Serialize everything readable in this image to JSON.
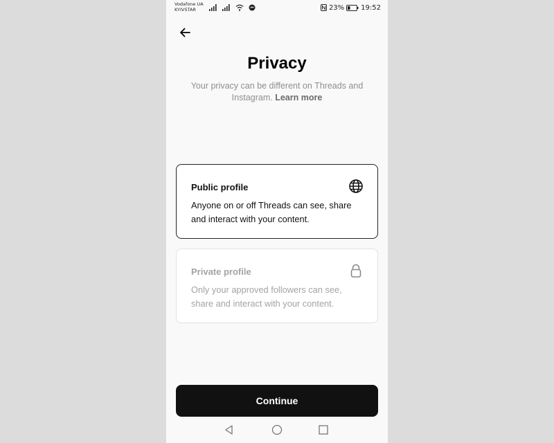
{
  "status_bar": {
    "carrier_line1": "Vodafone UA",
    "carrier_line2": "KYIVSTAR",
    "battery_percent": "23%",
    "time": "19:52"
  },
  "header": {
    "title": "Privacy",
    "subtitle": "Your privacy can be different on Threads and Instagram.",
    "learn_more": "Learn more"
  },
  "options": {
    "public": {
      "title": "Public profile",
      "description": "Anyone on or off Threads can see, share and interact with your content.",
      "icon": "globe-icon",
      "selected": true
    },
    "private": {
      "title": "Private profile",
      "description": "Only your approved followers can see, share and interact with your content.",
      "icon": "lock-icon",
      "selected": false
    }
  },
  "continue_label": "Continue",
  "colors": {
    "page_background": "#dcdcdc",
    "screen_background": "#f9f9f9",
    "button_background": "#111111",
    "muted_text": "#8e8e8e"
  }
}
